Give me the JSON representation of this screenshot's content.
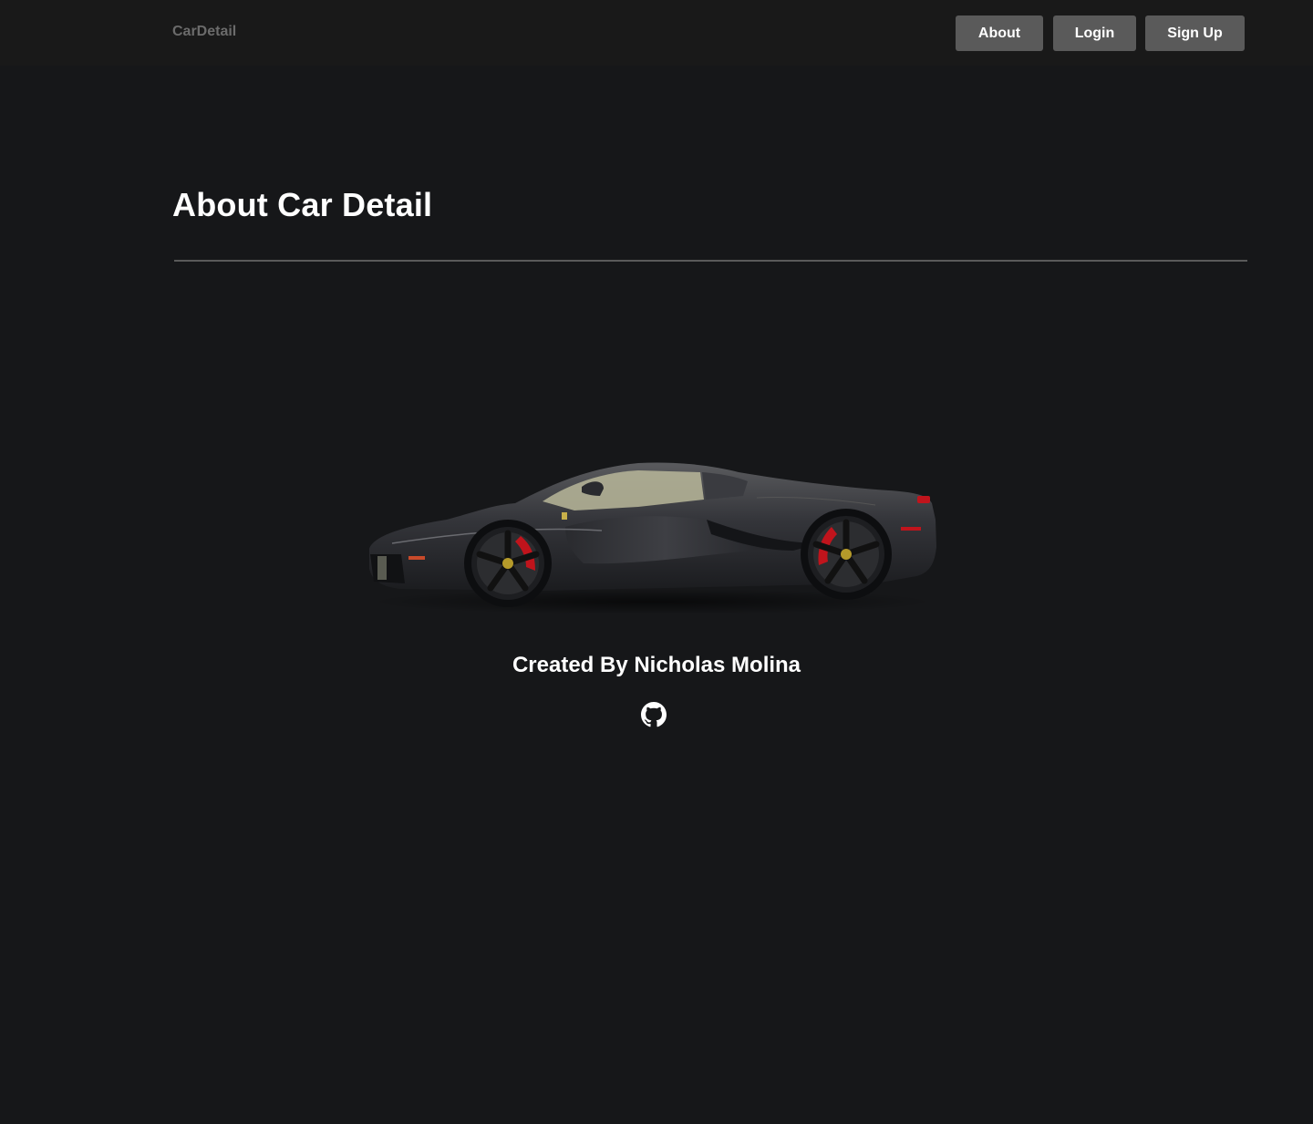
{
  "navbar": {
    "brand": "CarDetail",
    "buttons": {
      "about": "About",
      "login": "Login",
      "signup": "Sign Up"
    }
  },
  "main": {
    "title": "About Car Detail",
    "car_image_icon": "sports-car-image",
    "credit": "Created By Nicholas Molina",
    "github_icon": "github-icon"
  },
  "colors": {
    "background": "#161719",
    "navbar": "#191919",
    "button": "#5a5a5a",
    "brand_text": "#6b6b6b",
    "text": "#ffffff",
    "brake_caliper": "#c0141c"
  }
}
